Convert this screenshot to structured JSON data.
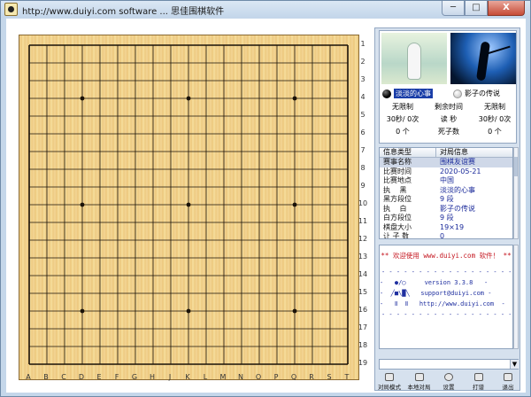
{
  "window": {
    "title": "http://www.duiyi.com software ... 思佳围棋软件",
    "minimize": "─",
    "maximize": "□",
    "close": "X"
  },
  "board": {
    "size": 19,
    "columns": [
      "A",
      "B",
      "C",
      "D",
      "E",
      "F",
      "G",
      "H",
      "J",
      "K",
      "L",
      "M",
      "N",
      "O",
      "P",
      "Q",
      "R",
      "S",
      "T"
    ],
    "rows": [
      "1",
      "2",
      "3",
      "4",
      "5",
      "6",
      "7",
      "8",
      "9",
      "10",
      "11",
      "12",
      "13",
      "14",
      "15",
      "16",
      "17",
      "18",
      "19"
    ],
    "star_points": [
      [
        3,
        3
      ],
      [
        3,
        9
      ],
      [
        3,
        15
      ],
      [
        9,
        3
      ],
      [
        9,
        9
      ],
      [
        9,
        15
      ],
      [
        15,
        3
      ],
      [
        15,
        9
      ],
      [
        15,
        15
      ]
    ],
    "colors": {
      "wood": "#f3d596",
      "line": "#1a1208"
    }
  },
  "players": {
    "black": {
      "name": "淡淡的心事",
      "time_mode": "无限制",
      "byoyomi": "30秒/ 0次",
      "captures": "0 个"
    },
    "white": {
      "name": "影子の传说",
      "time_mode": "无限制",
      "byoyomi": "30秒/ 0次",
      "captures": "0 个"
    },
    "labels": {
      "remaining_time": "剩余时间",
      "read_seconds": "读 秒",
      "dead_stones": "死子数"
    }
  },
  "info_table": {
    "headers": [
      "信息类型",
      "对局信息"
    ],
    "rows": [
      {
        "key": "赛事名称",
        "value": "围棋友谊赛"
      },
      {
        "key": "比赛时间",
        "value": "2020-05-21"
      },
      {
        "key": "比赛地点",
        "value": "中国"
      },
      {
        "key": "执　 黑",
        "value": "淡淡的心事"
      },
      {
        "key": "黑方段位",
        "value": "9 段"
      },
      {
        "key": "执　 白",
        "value": "影子の传说"
      },
      {
        "key": "白方段位",
        "value": "9 段"
      },
      {
        "key": "棋盘大小",
        "value": "19×19"
      },
      {
        "key": "让 子 数",
        "value": "0"
      }
    ]
  },
  "message_box": {
    "welcome": "** 欢迎使用 www.duiyi.com 软件！ **",
    "separator": "- - - - - - - - - - - - - - - - - - - - - - - - -",
    "lines": [
      "-   ●/◯     version 3.3.8   -",
      "-  ╱■\\█╲   support@duiyi.com -",
      "-   Ⅱ  Ⅱ   http://www.duiyi.com  -"
    ]
  },
  "chat": {
    "value": ""
  },
  "toolbar": {
    "buttons": [
      {
        "label": "对局模式"
      },
      {
        "label": "本地对局"
      },
      {
        "label": "设置"
      },
      {
        "label": "打谱"
      },
      {
        "label": "退出"
      }
    ]
  }
}
